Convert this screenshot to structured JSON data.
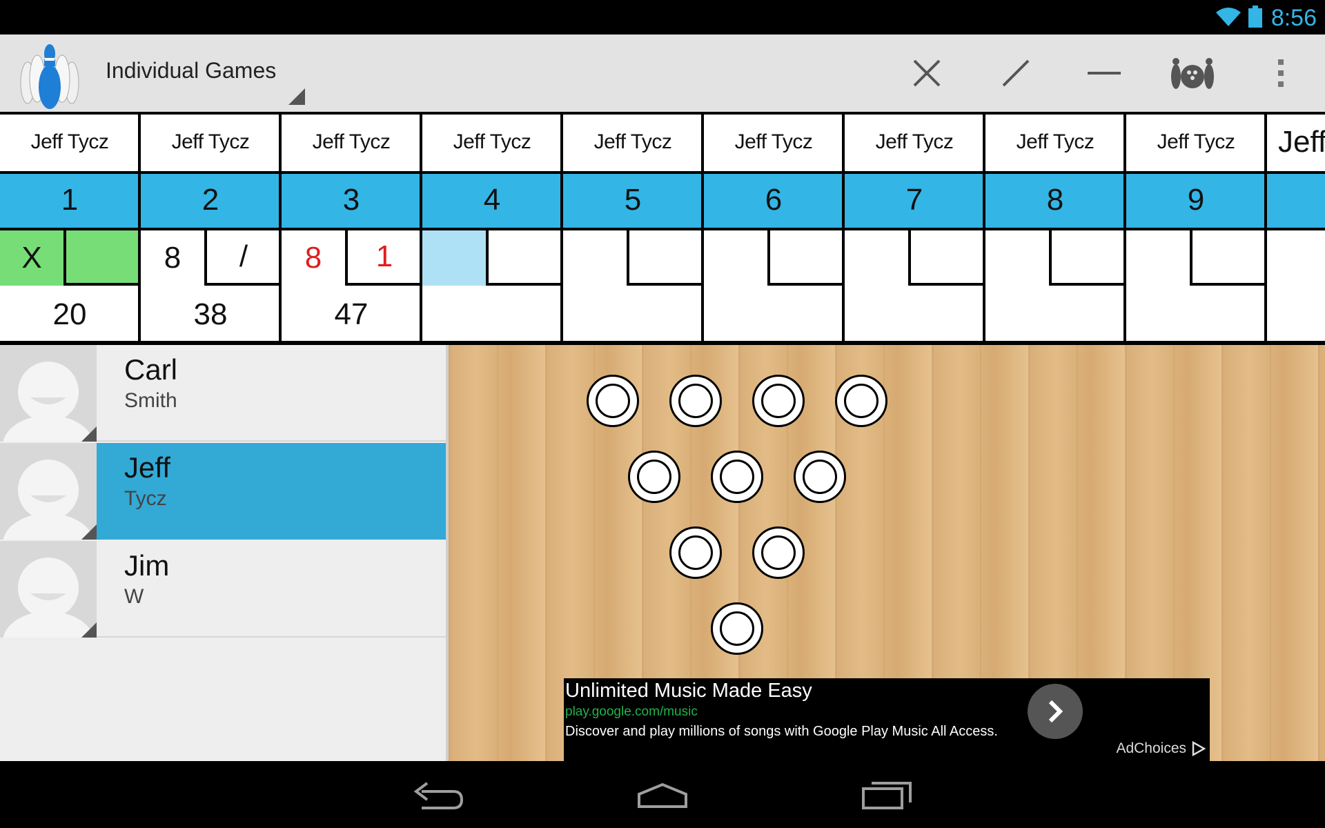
{
  "status_bar": {
    "time": "8:56",
    "accent": "#33b5e5"
  },
  "action_bar": {
    "title": "Individual Games",
    "actions": [
      {
        "name": "strike-x-icon"
      },
      {
        "name": "spare-slash-icon"
      },
      {
        "name": "miss-dash-icon"
      },
      {
        "name": "pins-ball-icon"
      },
      {
        "name": "overflow-menu-icon"
      }
    ]
  },
  "scorecard": {
    "frames": [
      {
        "player": "Jeff Tycz",
        "number": "1",
        "ball1": "X",
        "ball2": "",
        "total": "20"
      },
      {
        "player": "Jeff Tycz",
        "number": "2",
        "ball1": "8",
        "ball2": "/",
        "total": "38"
      },
      {
        "player": "Jeff Tycz",
        "number": "3",
        "ball1": "8",
        "ball2": "1",
        "total": "47"
      },
      {
        "player": "Jeff Tycz",
        "number": "4",
        "ball1": "",
        "ball2": "",
        "total": ""
      },
      {
        "player": "Jeff Tycz",
        "number": "5",
        "ball1": "",
        "ball2": "",
        "total": ""
      },
      {
        "player": "Jeff Tycz",
        "number": "6",
        "ball1": "",
        "ball2": "",
        "total": ""
      },
      {
        "player": "Jeff Tycz",
        "number": "7",
        "ball1": "",
        "ball2": "",
        "total": ""
      },
      {
        "player": "Jeff Tycz",
        "number": "8",
        "ball1": "",
        "ball2": "",
        "total": ""
      },
      {
        "player": "Jeff Tycz",
        "number": "9",
        "ball1": "",
        "ball2": "",
        "total": ""
      }
    ],
    "partial_player": "Jeff",
    "colors": {
      "header": "#33b5e5",
      "strike": "#77dd77",
      "current": "#aee1f5",
      "open": "#e01e1e"
    }
  },
  "bowlers": [
    {
      "first": "Carl",
      "last": "Smith",
      "selected": false
    },
    {
      "first": "Jeff",
      "last": "Tycz",
      "selected": true
    },
    {
      "first": "Jim",
      "last": "W",
      "selected": false
    }
  ],
  "lane": {
    "pins_standing": 10
  },
  "ad": {
    "headline": "Unlimited Music Made Easy",
    "url": "play.google.com/music",
    "description": "Discover and play millions of songs with Google Play Music All Access.",
    "adchoices": "AdChoices"
  },
  "nav_bar": {
    "buttons": [
      "back-icon",
      "home-icon",
      "recents-icon"
    ]
  }
}
